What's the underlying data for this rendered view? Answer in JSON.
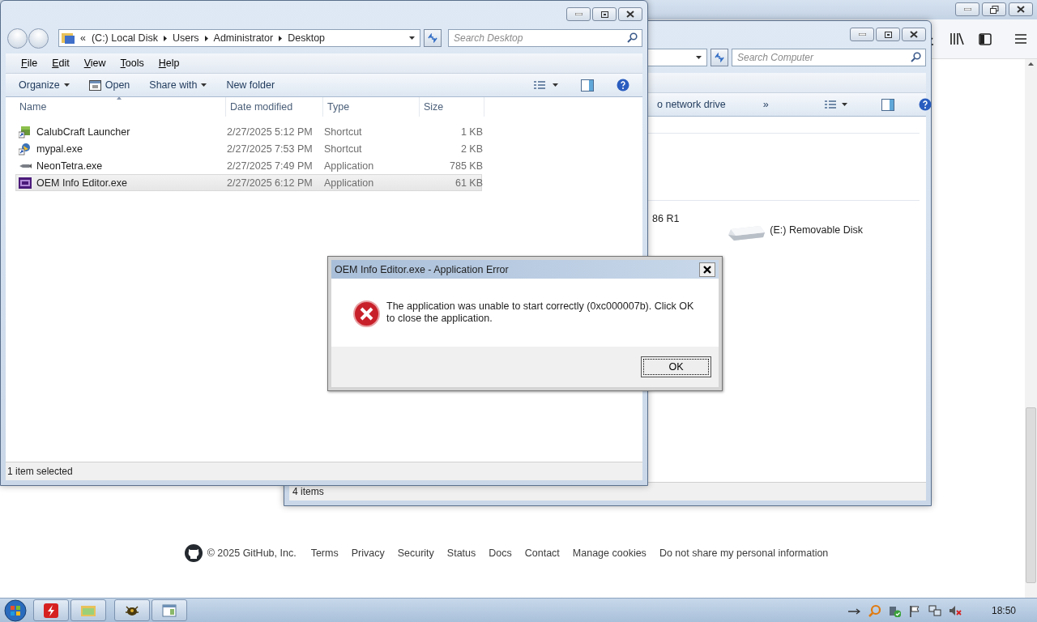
{
  "browser": {
    "footer": {
      "copyright": "© 2025 GitHub, Inc.",
      "links": [
        "Terms",
        "Privacy",
        "Security",
        "Status",
        "Docs",
        "Contact",
        "Manage cookies",
        "Do not share my personal information"
      ]
    }
  },
  "computer_window": {
    "search": {
      "placeholder": "Search Computer"
    },
    "toolbar": [
      "o network drive",
      "»"
    ],
    "items": [
      {
        "label": "86 R1",
        "kind": "text"
      },
      {
        "label": "(E:) Removable Disk",
        "kind": "drive"
      }
    ],
    "status": "4 items"
  },
  "explorer": {
    "breadcrumb": [
      "«",
      "(C:) Local Disk",
      "Users",
      "Administrator",
      "Desktop"
    ],
    "search": {
      "placeholder": "Search Desktop"
    },
    "menu": [
      "File",
      "Edit",
      "View",
      "Tools",
      "Help"
    ],
    "toolbar": [
      {
        "label": "Organize",
        "kind": "dropdown"
      },
      {
        "label": "Open",
        "kind": "icon"
      },
      {
        "label": "Share with",
        "kind": "dropdown"
      },
      {
        "label": "New folder",
        "kind": "plain"
      }
    ],
    "columns": [
      "Name",
      "Date modified",
      "Type",
      "Size"
    ],
    "rows": [
      {
        "name": "CalubCraft Launcher",
        "date": "2/27/2025 5:12 PM",
        "type": "Shortcut",
        "size": "1 KB",
        "selected": false
      },
      {
        "name": "mypal.exe",
        "date": "2/27/2025 7:53 PM",
        "type": "Shortcut",
        "size": "2 KB",
        "selected": false
      },
      {
        "name": "NeonTetra.exe",
        "date": "2/27/2025 7:49 PM",
        "type": "Application",
        "size": "785 KB",
        "selected": false
      },
      {
        "name": "OEM Info Editor.exe",
        "date": "2/27/2025 6:12 PM",
        "type": "Application",
        "size": "61 KB",
        "selected": true
      }
    ],
    "status": "1 item selected"
  },
  "dialog": {
    "title": "OEM Info Editor.exe - Application Error",
    "message": "The application was unable to start correctly (0xc000007b). Click OK to close the application.",
    "buttons": [
      "OK"
    ]
  },
  "taskbar": {
    "clock": "18:50"
  }
}
